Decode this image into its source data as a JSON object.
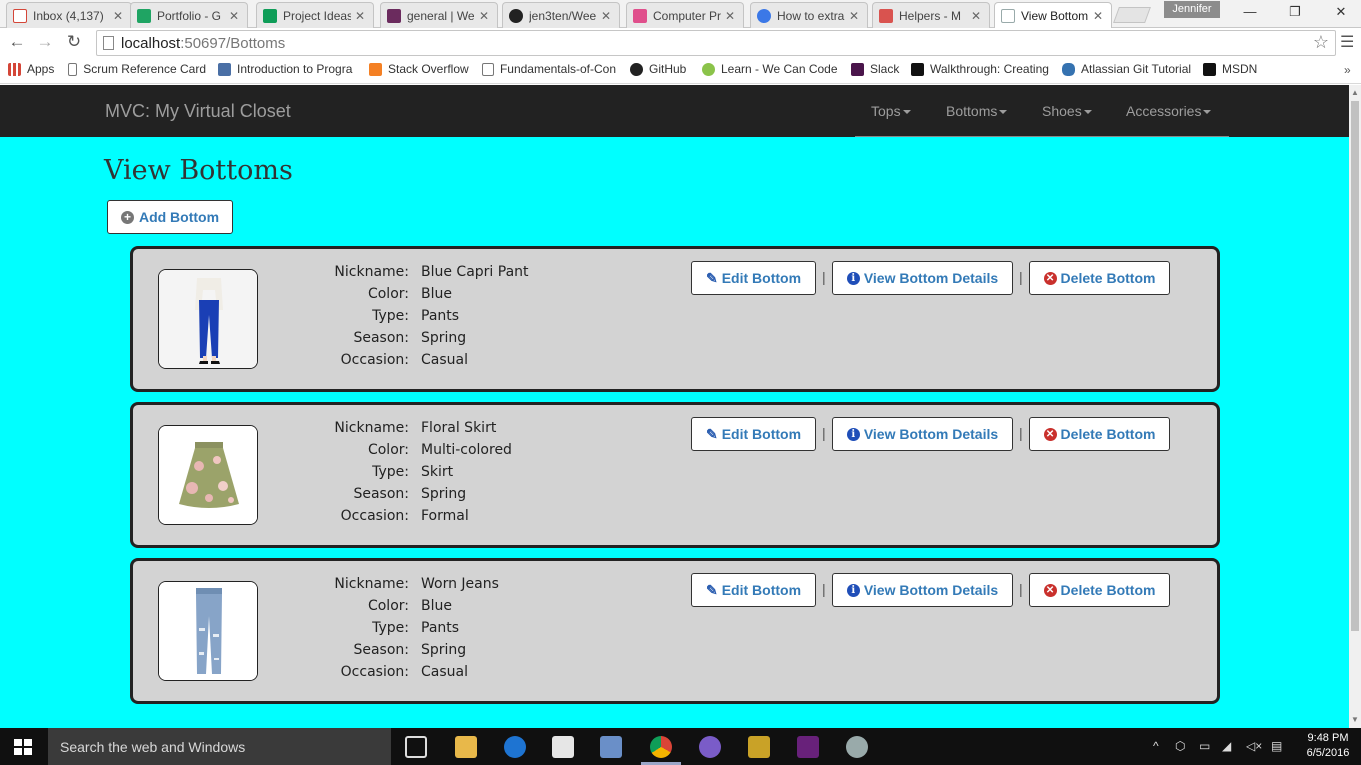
{
  "browser": {
    "tabs": [
      {
        "label": "Inbox (4,137)",
        "color": "#d44638"
      },
      {
        "label": "Portfolio - G",
        "color": "#1fa463"
      },
      {
        "label": "Project Ideas",
        "color": "#0f9d58"
      },
      {
        "label": "general | We",
        "color": "#6b2b5e"
      },
      {
        "label": "jen3ten/Wee",
        "color": "#222222"
      },
      {
        "label": "Computer Pr",
        "color": "#e04f8c"
      },
      {
        "label": "How to extra",
        "color": "#3b78e7"
      },
      {
        "label": "Helpers - M",
        "color": "#d9534f"
      },
      {
        "label": "View Bottom",
        "color": "#cfd8e6"
      }
    ],
    "profile": "Jennifer",
    "url_host": "localhost",
    "url_rest": ":50697/Bottoms",
    "bookmarks": [
      {
        "label": "Apps",
        "icon": "apps-grid-icon",
        "color": "#d44638"
      },
      {
        "label": "Scrum Reference Card",
        "icon": "page-icon",
        "color": "#ffffff"
      },
      {
        "label": "Introduction to Progra",
        "icon": "bird-icon",
        "color": "#4a6fa5"
      },
      {
        "label": "Stack Overflow",
        "icon": "stackoverflow-icon",
        "color": "#f48024"
      },
      {
        "label": "Fundamentals-of-Con",
        "icon": "page-icon",
        "color": "#ffffff"
      },
      {
        "label": "GitHub",
        "icon": "github-icon",
        "color": "#222222"
      },
      {
        "label": "Learn - We Can Code",
        "icon": "wecancode-icon",
        "color": "#8bc34a"
      },
      {
        "label": "Slack",
        "icon": "slack-icon",
        "color": "#4a154b"
      },
      {
        "label": "Walkthrough: Creating",
        "icon": "msdn-icon",
        "color": "#111111"
      },
      {
        "label": "Atlassian Git Tutorial",
        "icon": "database-icon",
        "color": "#3572b0"
      },
      {
        "label": "MSDN",
        "icon": "msdn-icon",
        "color": "#111111"
      }
    ]
  },
  "site": {
    "brand": "MVC: My Virtual Closet",
    "menu": [
      "Tops",
      "Bottoms",
      "Shoes",
      "Accessories"
    ],
    "title": "View Bottoms",
    "add_button": "Add Bottom",
    "labels": {
      "nickname": "Nickname:",
      "color": "Color:",
      "type": "Type:",
      "season": "Season:",
      "occasion": "Occasion:"
    },
    "actions": {
      "edit": "Edit Bottom",
      "view": "View Bottom Details",
      "delete": "Delete Bottom",
      "separator": "|"
    },
    "items": [
      {
        "nickname": "Blue Capri Pant",
        "color": "Blue",
        "type": "Pants",
        "season": "Spring",
        "occasion": "Casual",
        "image": "blue-capri-pants-image"
      },
      {
        "nickname": "Floral Skirt",
        "color": "Multi-colored",
        "type": "Skirt",
        "season": "Spring",
        "occasion": "Formal",
        "image": "floral-skirt-image"
      },
      {
        "nickname": "Worn Jeans",
        "color": "Blue",
        "type": "Pants",
        "season": "Spring",
        "occasion": "Casual",
        "image": "worn-jeans-image"
      }
    ]
  },
  "taskbar": {
    "search_placeholder": "Search the web and Windows",
    "time": "9:48 PM",
    "date": "6/5/2016"
  },
  "colors": {
    "page_background": "#00ffff",
    "navbar": "#222222",
    "card_background": "#d3d3d3",
    "link_blue": "#337ab7"
  }
}
